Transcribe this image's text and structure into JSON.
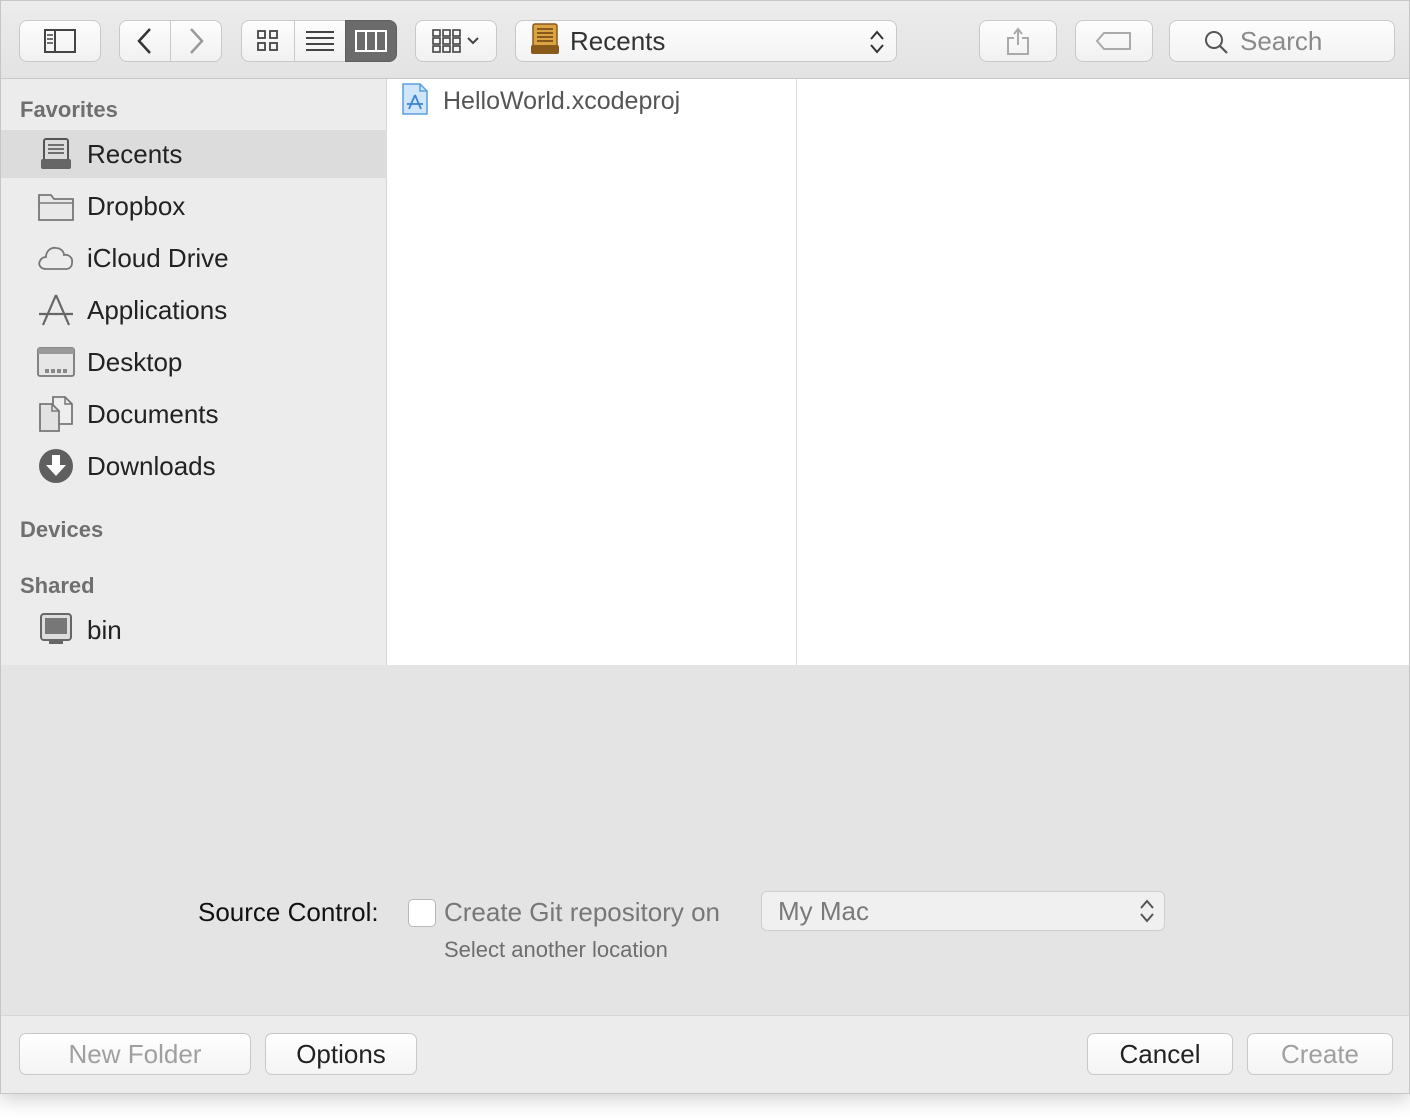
{
  "toolbar": {
    "location": "Recents",
    "search_placeholder": "Search"
  },
  "sidebar": {
    "favorites_header": "Favorites",
    "favorites": [
      {
        "label": "Recents",
        "icon": "recents-icon",
        "selected": true
      },
      {
        "label": "Dropbox",
        "icon": "folder-icon"
      },
      {
        "label": "iCloud Drive",
        "icon": "cloud-icon"
      },
      {
        "label": "Applications",
        "icon": "applications-icon"
      },
      {
        "label": "Desktop",
        "icon": "desktop-icon"
      },
      {
        "label": "Documents",
        "icon": "documents-icon"
      },
      {
        "label": "Downloads",
        "icon": "download-icon"
      }
    ],
    "devices_header": "Devices",
    "shared_header": "Shared",
    "shared": [
      {
        "label": "bin",
        "icon": "computer-icon"
      }
    ]
  },
  "browser": {
    "files": [
      {
        "name": "HelloWorld.xcodeproj",
        "icon": "xcodeproj-icon"
      }
    ]
  },
  "options": {
    "source_control_label": "Source Control:",
    "git_checkbox_label": "Create Git repository on",
    "git_checked": false,
    "location_value": "My Mac",
    "select_another": "Select another location"
  },
  "buttons": {
    "new_folder": "New Folder",
    "options": "Options",
    "cancel": "Cancel",
    "create": "Create"
  }
}
